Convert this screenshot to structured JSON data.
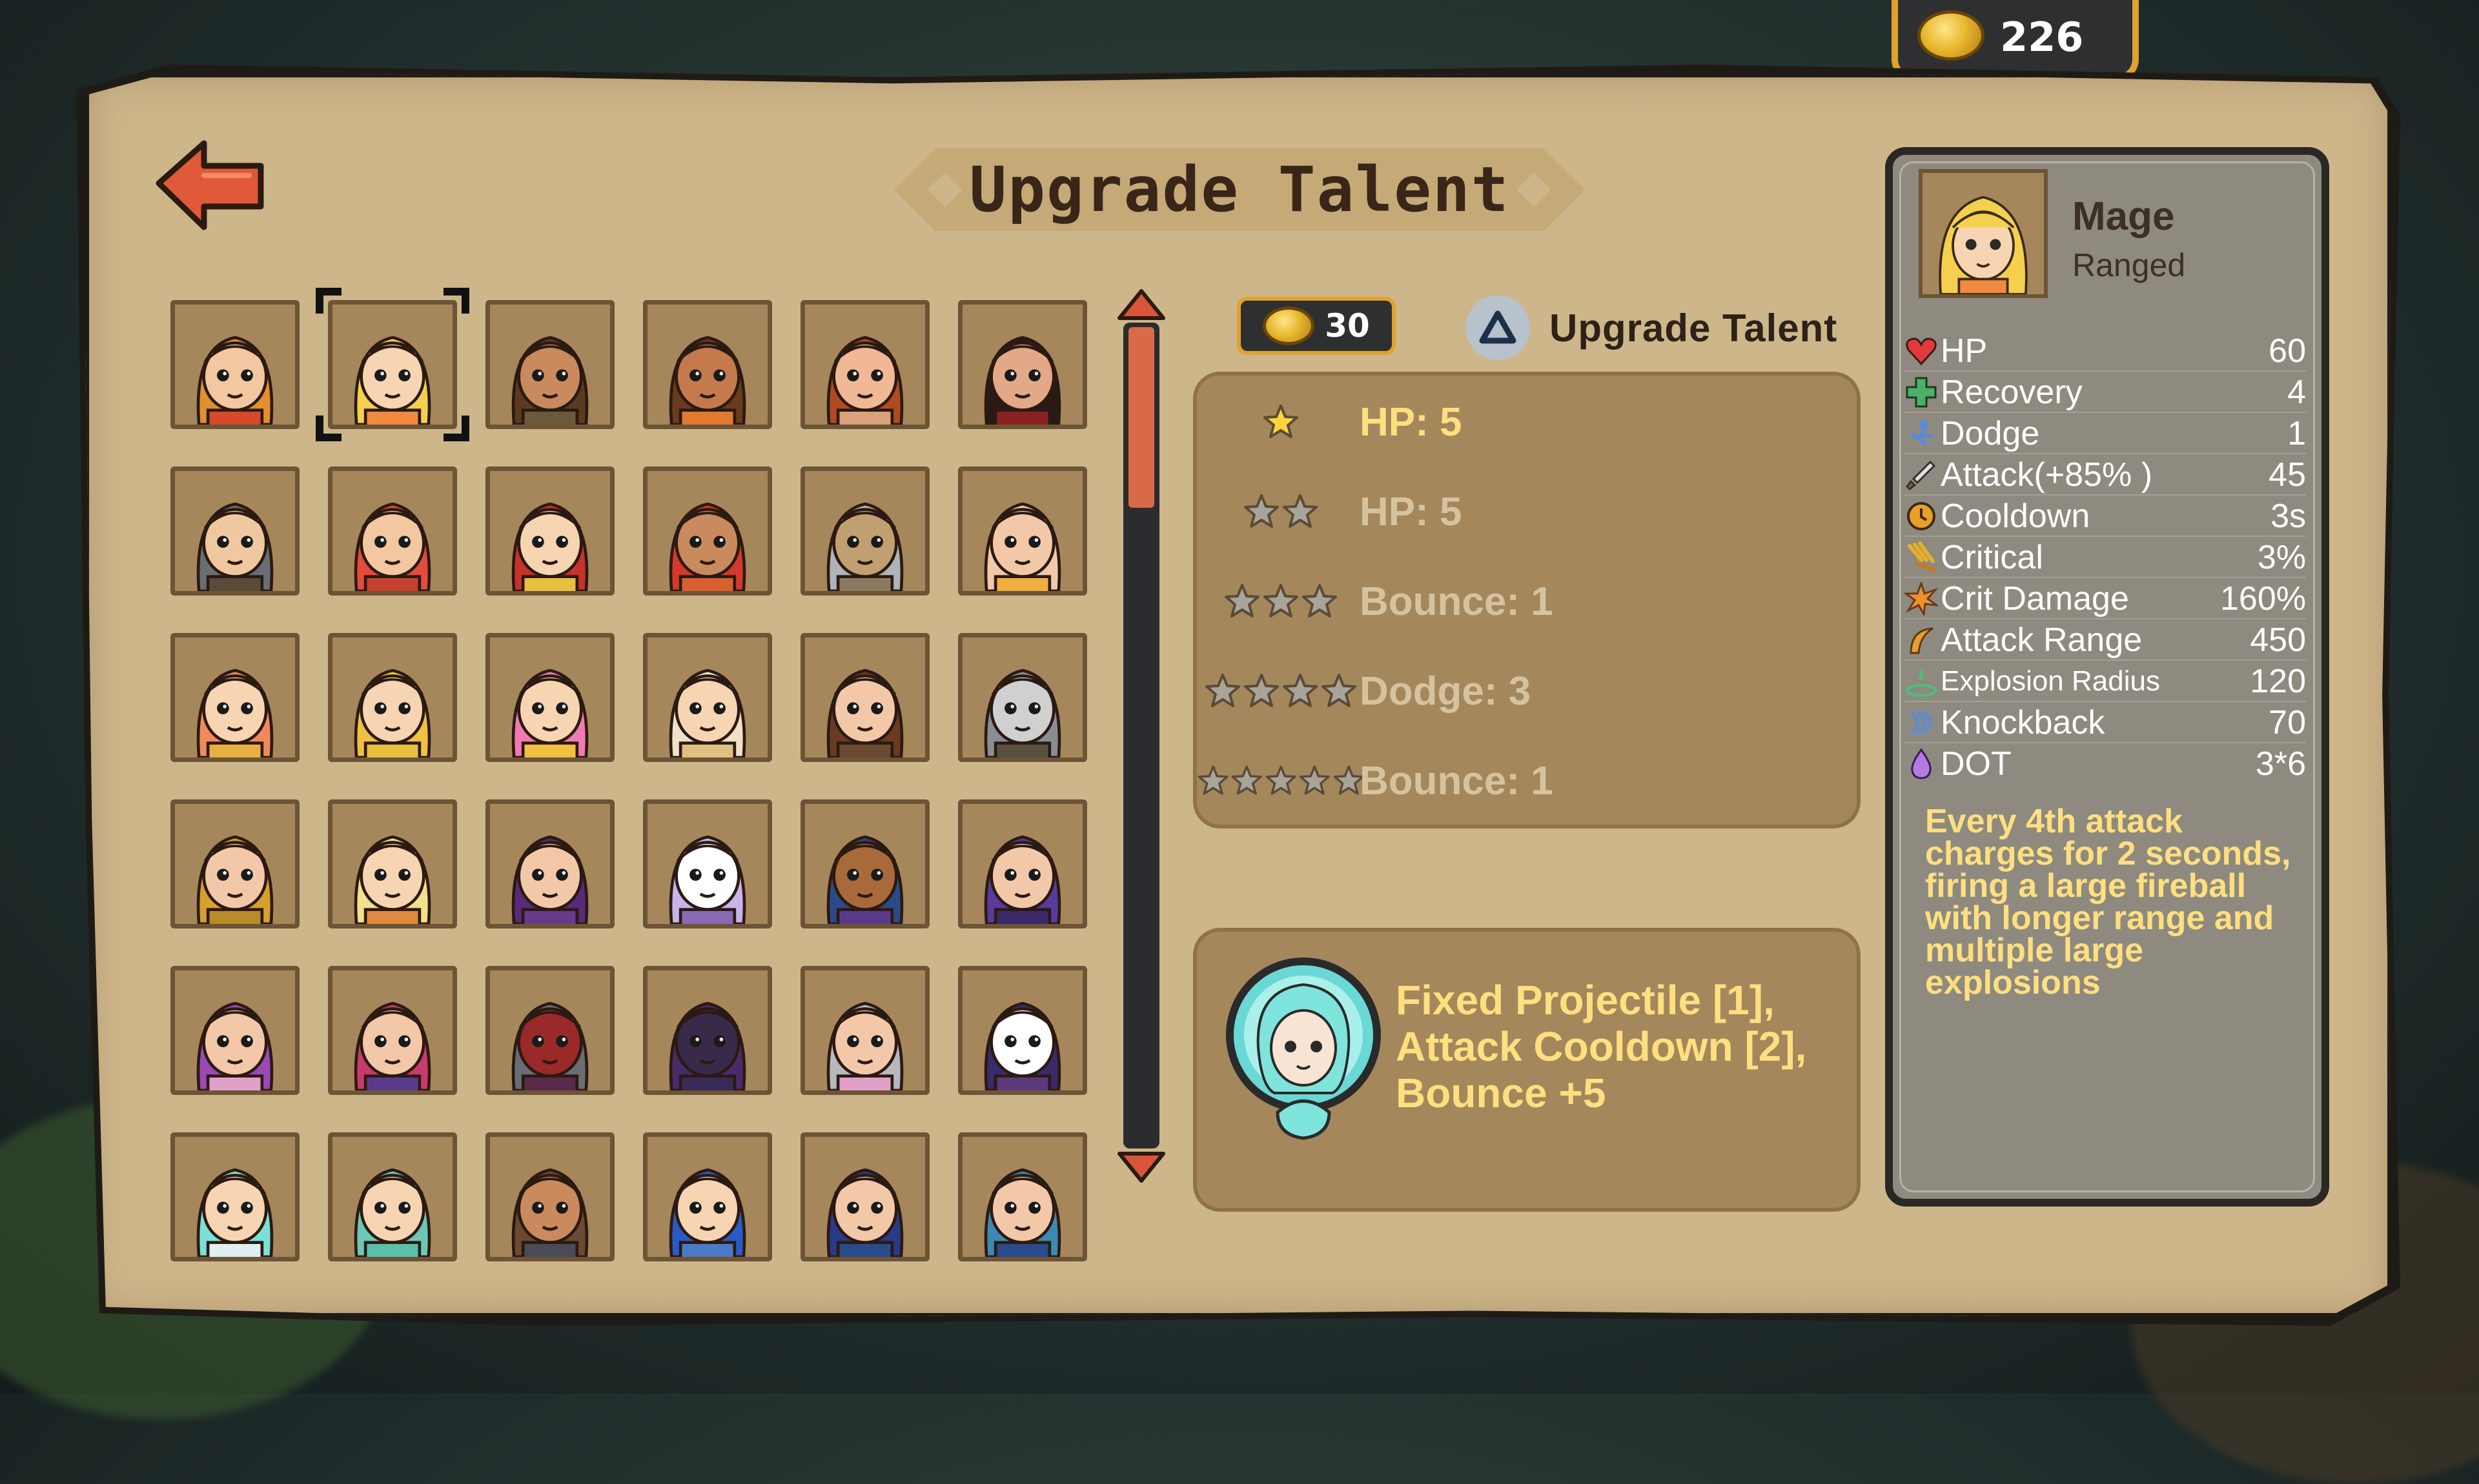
{
  "currency": {
    "coins": "226"
  },
  "header": {
    "title": "Upgrade Talent"
  },
  "colors": {
    "parchment": "#ceb68b",
    "accent_gold": "#e0a22b",
    "active_text": "#ffdf80",
    "inactive_text": "#d5c39f",
    "selected_hero_bg": "#a6875c"
  },
  "heroes": [
    {
      "name": "hero-1",
      "hair": "#e0902c",
      "skin": "#f3c79f",
      "shirt": "#d44a2a",
      "sel": false
    },
    {
      "name": "hero-2",
      "hair": "#f5cf4e",
      "skin": "#f7d4b2",
      "shirt": "#f08a40",
      "sel": true
    },
    {
      "name": "hero-3",
      "hair": "#5a3a20",
      "skin": "#c98a5e",
      "shirt": "#6b5a3a",
      "sel": false
    },
    {
      "name": "hero-4",
      "hair": "#6a3b1c",
      "skin": "#c47a4c",
      "shirt": "#e07a30",
      "sel": false
    },
    {
      "name": "hero-5",
      "hair": "#b04a20",
      "skin": "#f0b894",
      "shirt": "#d8a27a",
      "sel": false
    },
    {
      "name": "hero-6",
      "hair": "#2a1a16",
      "skin": "#e2a888",
      "shirt": "#8a2222",
      "sel": false
    },
    {
      "name": "hero-7",
      "hair": "#6a6e74",
      "skin": "#f0c8a0",
      "shirt": "#5a4a3a",
      "sel": false
    },
    {
      "name": "hero-8",
      "hair": "#e54a3a",
      "skin": "#f3c79f",
      "shirt": "#c84030",
      "sel": false
    },
    {
      "name": "hero-9",
      "hair": "#c8322c",
      "skin": "#f7d4b2",
      "shirt": "#e8c040",
      "sel": false
    },
    {
      "name": "hero-10",
      "hair": "#d43a2a",
      "skin": "#c98a5e",
      "shirt": "#d86030",
      "sel": false
    },
    {
      "name": "hero-11",
      "hair": "#b0b4b8",
      "skin": "#c0a070",
      "shirt": "#8a7a60",
      "sel": false
    },
    {
      "name": "hero-12",
      "hair": "#f2c8a8",
      "skin": "#f2c8a8",
      "shirt": "#f0b040",
      "sel": false
    },
    {
      "name": "hero-13",
      "hair": "#f08a5a",
      "skin": "#f7d4b2",
      "shirt": "#e8b040",
      "sel": false
    },
    {
      "name": "hero-14",
      "hair": "#f0c040",
      "skin": "#f7d4b2",
      "shirt": "#e8c040",
      "sel": false
    },
    {
      "name": "hero-15",
      "hair": "#f27ab4",
      "skin": "#f7d4b2",
      "shirt": "#f0c040",
      "sel": false
    },
    {
      "name": "hero-16",
      "hair": "#f0e0c8",
      "skin": "#f7d4b2",
      "shirt": "#e0c080",
      "sel": false
    },
    {
      "name": "hero-17",
      "hair": "#6a3a22",
      "skin": "#f2c8a8",
      "shirt": "#6a4a30",
      "sel": false
    },
    {
      "name": "hero-18",
      "hair": "#8a8e94",
      "skin": "#d0d0d0",
      "shirt": "#5a5040",
      "sel": false
    },
    {
      "name": "hero-19",
      "hair": "#d8a02a",
      "skin": "#f2c8a8",
      "shirt": "#b88a2a",
      "sel": false
    },
    {
      "name": "hero-20",
      "hair": "#f3e08a",
      "skin": "#f7d4b2",
      "shirt": "#e08a40",
      "sel": false
    },
    {
      "name": "hero-21",
      "hair": "#5a2a7a",
      "skin": "#f2c8a8",
      "shirt": "#6a3a8a",
      "sel": false
    },
    {
      "name": "hero-22",
      "hair": "#c8b4e8",
      "skin": "#ffffff",
      "shirt": "#8a6ab4",
      "sel": false
    },
    {
      "name": "hero-23",
      "hair": "#2a4a8a",
      "skin": "#a86a3a",
      "shirt": "#5a3a8a",
      "sel": false
    },
    {
      "name": "hero-24",
      "hair": "#5a3a9a",
      "skin": "#f2c8a8",
      "shirt": "#3a2a6a",
      "sel": false
    },
    {
      "name": "hero-25",
      "hair": "#9a4ab4",
      "skin": "#f2c8a8",
      "shirt": "#e0a0c8",
      "sel": false
    },
    {
      "name": "hero-26",
      "hair": "#c83a6a",
      "skin": "#f2c8a8",
      "shirt": "#5a3a8a",
      "sel": false
    },
    {
      "name": "hero-27",
      "hair": "#6a6e74",
      "skin": "#9a2a2a",
      "shirt": "#5a2a4a",
      "sel": false
    },
    {
      "name": "hero-28",
      "hair": "#4a2a6a",
      "skin": "#3a2a4a",
      "shirt": "#3a2a5a",
      "sel": false
    },
    {
      "name": "hero-29",
      "hair": "#b8b8c0",
      "skin": "#f2c8a8",
      "shirt": "#e0a0c8",
      "sel": false
    },
    {
      "name": "hero-30",
      "hair": "#3a2a6a",
      "skin": "#ffffff",
      "shirt": "#5a3a7a",
      "sel": false
    },
    {
      "name": "hero-31",
      "hair": "#7ae0d8",
      "skin": "#f7d4b2",
      "shirt": "#e0f0f0",
      "sel": false
    },
    {
      "name": "hero-32",
      "hair": "#6ac8b4",
      "skin": "#f7d4b2",
      "shirt": "#5ac0a8",
      "sel": false
    },
    {
      "name": "hero-33",
      "hair": "#6a4a30",
      "skin": "#c98a5e",
      "shirt": "#4a4a58",
      "sel": false
    },
    {
      "name": "hero-34",
      "hair": "#2a5ac8",
      "skin": "#f7d4b2",
      "shirt": "#4a7ac8",
      "sel": false
    },
    {
      "name": "hero-35",
      "hair": "#2a3a8a",
      "skin": "#f2c8a8",
      "shirt": "#2a4a8a",
      "sel": false
    },
    {
      "name": "hero-36",
      "hair": "#3a8ab4",
      "skin": "#f2c8a8",
      "shirt": "#2a4a8a",
      "sel": false
    }
  ],
  "talents": {
    "cost": "30",
    "upgrade_label": "Upgrade Talent",
    "rows": [
      {
        "stars": 1,
        "text": "HP: 5",
        "active": true
      },
      {
        "stars": 2,
        "text": "HP: 5",
        "active": false
      },
      {
        "stars": 3,
        "text": "Bounce: 1",
        "active": false
      },
      {
        "stars": 4,
        "text": "Dodge: 3",
        "active": false
      },
      {
        "stars": 5,
        "text": "Bounce: 1",
        "active": false
      }
    ]
  },
  "skill": {
    "text_line1": "Fixed Projectile [1],",
    "text_line2": "Attack Cooldown [2],",
    "text_line3": "Bounce +5"
  },
  "hero_detail": {
    "name": "Mage",
    "type": "Ranged",
    "stats": [
      {
        "icon": "heart-icon",
        "label": "HP",
        "value": "60"
      },
      {
        "icon": "recovery-cross-icon",
        "label": "Recovery",
        "value": "4"
      },
      {
        "icon": "dodge-icon",
        "label": "Dodge",
        "value": "1"
      },
      {
        "icon": "sword-icon",
        "label": "Attack(+85%  )",
        "value": "45"
      },
      {
        "icon": "clock-icon",
        "label": "Cooldown",
        "value": "3s"
      },
      {
        "icon": "critical-icon",
        "label": "Critical",
        "value": "3%"
      },
      {
        "icon": "burst-icon",
        "label": "Crit Damage",
        "value": "160%"
      },
      {
        "icon": "range-icon",
        "label": "Attack Range",
        "value": "450"
      },
      {
        "icon": "explosion-icon",
        "label": "Explosion Radius",
        "value": "120"
      },
      {
        "icon": "knockback-icon",
        "label": "Knockback",
        "value": "70"
      },
      {
        "icon": "droplet-icon",
        "label": "DOT",
        "value": "3*6"
      }
    ],
    "description": "Every 4th attack charges for 2 seconds, firing a large fireball with longer range and multiple large explosions"
  }
}
